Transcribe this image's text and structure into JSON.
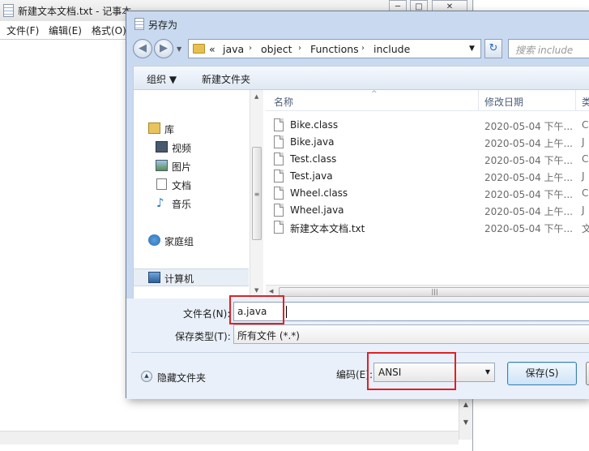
{
  "notepad": {
    "title": "新建文本文档.txt - 记事本",
    "menu": [
      "文件(F)",
      "编辑(E)",
      "格式(O)"
    ],
    "window_controls": [
      "─",
      "□",
      "✕"
    ],
    "scroll_arrow": "▼",
    "scroll_arrow_up": "▲"
  },
  "dialog": {
    "title": "另存为",
    "nav": {
      "back": "◀",
      "forward": "▶",
      "dropdown": "▼",
      "breadcrumb_prefix": "«",
      "breadcrumb": [
        "java",
        "object",
        "Functions",
        "include"
      ],
      "separator": "›",
      "address_dropdown": "▼",
      "refresh": "↻",
      "search_placeholder": "搜索 include"
    },
    "toolbar": {
      "organize": "组织 ▼",
      "new_folder": "新建文件夹"
    },
    "nav_pane": {
      "items": [
        "库",
        "视频",
        "图片",
        "文档",
        "音乐",
        "家庭组",
        "计算机"
      ],
      "scroll_grip": "≡",
      "scroll_up": "▲",
      "scroll_down": "▼"
    },
    "file_list": {
      "headers": [
        "名称",
        "修改日期",
        "类"
      ],
      "sort_indicator": "^",
      "files": [
        {
          "name": "Bike.class",
          "date": "2020-05-04 下午...",
          "type": "C"
        },
        {
          "name": "Bike.java",
          "date": "2020-05-04 上午...",
          "type": "J"
        },
        {
          "name": "Test.class",
          "date": "2020-05-04 下午...",
          "type": "C"
        },
        {
          "name": "Test.java",
          "date": "2020-05-04 上午...",
          "type": "J"
        },
        {
          "name": "Wheel.class",
          "date": "2020-05-04 下午...",
          "type": "C"
        },
        {
          "name": "Wheel.java",
          "date": "2020-05-04 上午...",
          "type": "J"
        },
        {
          "name": "新建文本文档.txt",
          "date": "2020-05-04 下午...",
          "type": "文"
        }
      ],
      "hscroll_left": "◀",
      "hscroll_grip": "|||"
    },
    "form": {
      "filename_label": "文件名(N):",
      "filename_value": "a.java",
      "filetype_label": "保存类型(T):",
      "filetype_value": "所有文件 (*.*)",
      "hide_folders_icon": "▲",
      "hide_folders": "隐藏文件夹",
      "encoding_label": "编码(E):",
      "encoding_value": "ANSI",
      "encoding_arrow": "▼",
      "save_button": "保存(S)"
    }
  },
  "colors": {
    "highlight": "#e21f26",
    "dialog_frame": "#c9daf0"
  }
}
